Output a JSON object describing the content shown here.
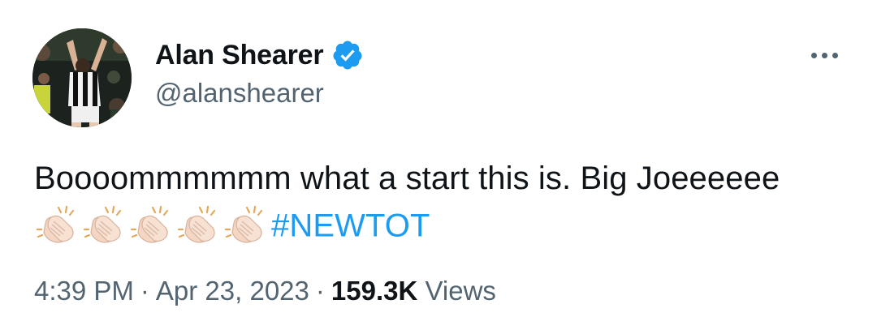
{
  "author": {
    "display_name": "Alan Shearer",
    "handle": "@alanshearer",
    "verified": true
  },
  "tweet": {
    "text": "Boooommmmmm what a start this is. Big Joeeeeee",
    "emoji": "👏🏻👏🏻👏🏻👏🏻👏🏻",
    "emoji_count": 5,
    "hashtag": "#NEWTOT"
  },
  "meta": {
    "time": "4:39 PM",
    "separator": "·",
    "date": "Apr 23, 2023",
    "views_count": "159.3K",
    "views_label": "Views"
  },
  "icons": {
    "verified": "verified-badge-icon",
    "more": "more-options-icon",
    "clap": "clapping-hands-icon"
  },
  "colors": {
    "text_primary": "#0f1419",
    "text_secondary": "#536471",
    "link": "#1d9bf0",
    "verified": "#1d9bf0"
  }
}
